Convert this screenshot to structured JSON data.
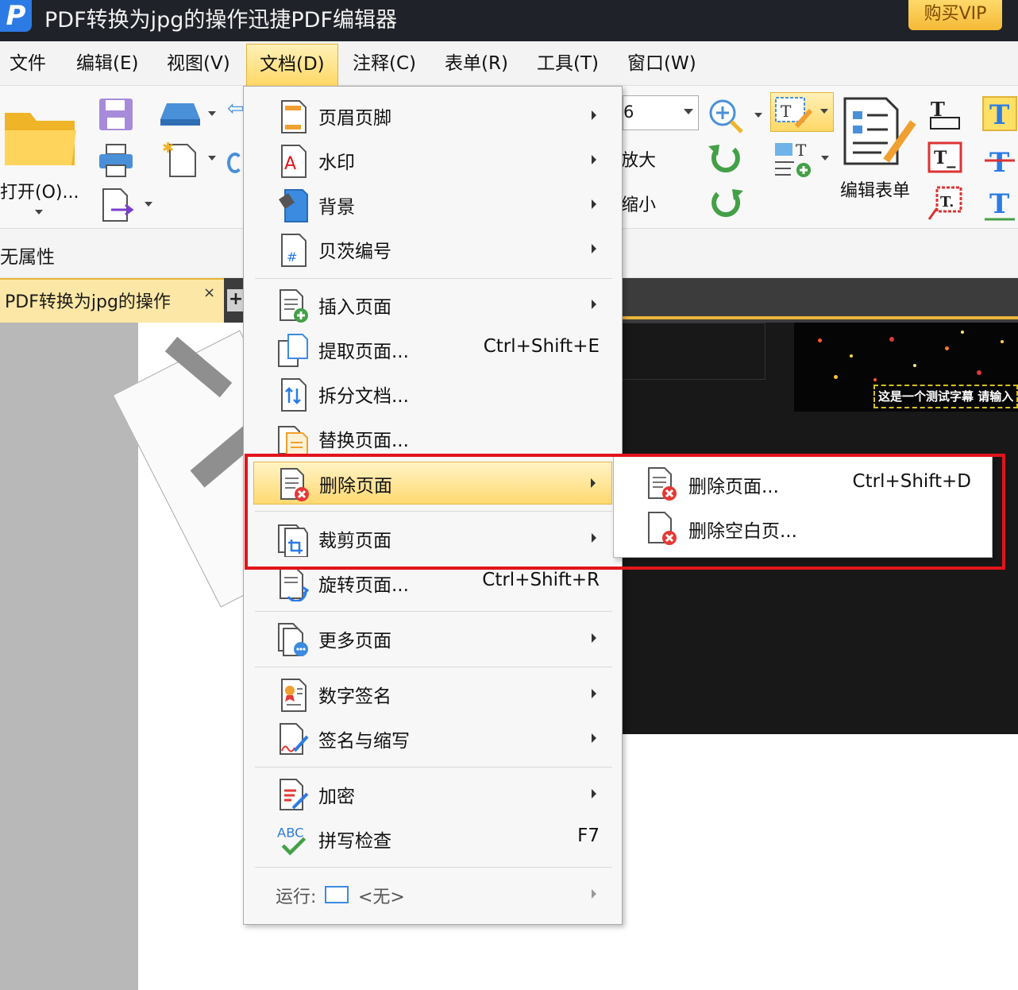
{
  "window": {
    "title": "PDF转换为jpg的操作迅捷PDF编辑器",
    "logo_letter": "P",
    "vip_label": "购买VIP"
  },
  "menubar": {
    "items": [
      "文件",
      "编辑(E)",
      "视图(V)",
      "文档(D)",
      "注释(C)",
      "表单(R)",
      "工具(T)",
      "窗口(W)"
    ],
    "active": "文档(D)"
  },
  "ribbon": {
    "open_label": "打开(O)...",
    "zoom_value": "6",
    "zoom_in_label": "放大",
    "zoom_out_label": "缩小",
    "edit_form_label": "编辑表单"
  },
  "properties": {
    "label": "无属性"
  },
  "tabs": {
    "active_label": "PDF转换为jpg的操作",
    "close_symbol": "×",
    "add_symbol": "+"
  },
  "video": {
    "subtitle": "这是一个测试字幕 请输入"
  },
  "doc_menu": {
    "items": [
      {
        "label": "页眉页脚",
        "shortcut": "",
        "submenu": true,
        "icon": "header-footer-icon"
      },
      {
        "label": "水印",
        "shortcut": "",
        "submenu": true,
        "icon": "watermark-icon"
      },
      {
        "label": "背景",
        "shortcut": "",
        "submenu": true,
        "icon": "background-icon"
      },
      {
        "label": "贝茨编号",
        "shortcut": "",
        "submenu": true,
        "icon": "bates-number-icon"
      },
      {
        "label": "插入页面",
        "shortcut": "",
        "submenu": true,
        "icon": "insert-page-icon"
      },
      {
        "label": "提取页面...",
        "shortcut": "Ctrl+Shift+E",
        "submenu": false,
        "icon": "extract-page-icon"
      },
      {
        "label": "拆分文档...",
        "shortcut": "",
        "submenu": false,
        "icon": "split-document-icon"
      },
      {
        "label": "替换页面...",
        "shortcut": "",
        "submenu": false,
        "icon": "replace-page-icon"
      },
      {
        "label": "删除页面",
        "shortcut": "",
        "submenu": true,
        "icon": "delete-page-icon",
        "highlighted": true
      },
      {
        "label": "裁剪页面",
        "shortcut": "",
        "submenu": true,
        "icon": "crop-page-icon"
      },
      {
        "label": "旋转页面...",
        "shortcut": "Ctrl+Shift+R",
        "submenu": false,
        "icon": "rotate-page-icon"
      },
      {
        "label": "更多页面",
        "shortcut": "",
        "submenu": true,
        "icon": "more-pages-icon"
      },
      {
        "label": "数字签名",
        "shortcut": "",
        "submenu": true,
        "icon": "digital-signature-icon"
      },
      {
        "label": "签名与缩写",
        "shortcut": "",
        "submenu": true,
        "icon": "sign-initials-icon"
      },
      {
        "label": "加密",
        "shortcut": "",
        "submenu": true,
        "icon": "encrypt-icon"
      },
      {
        "label": "拼写检查",
        "shortcut": "F7",
        "submenu": false,
        "icon": "spell-check-icon"
      }
    ],
    "run_label": "运行:",
    "run_value": "<无>"
  },
  "sub_menu": {
    "items": [
      {
        "label": "删除页面...",
        "shortcut": "Ctrl+Shift+D",
        "icon": "delete-page-icon"
      },
      {
        "label": "删除空白页...",
        "shortcut": "",
        "icon": "delete-blank-page-icon"
      }
    ]
  },
  "colors": {
    "highlight_border": "#e2141b",
    "menu_highlight": "#ffd972",
    "titlebar": "#1f2228",
    "accent_blue": "#2c7be5"
  }
}
